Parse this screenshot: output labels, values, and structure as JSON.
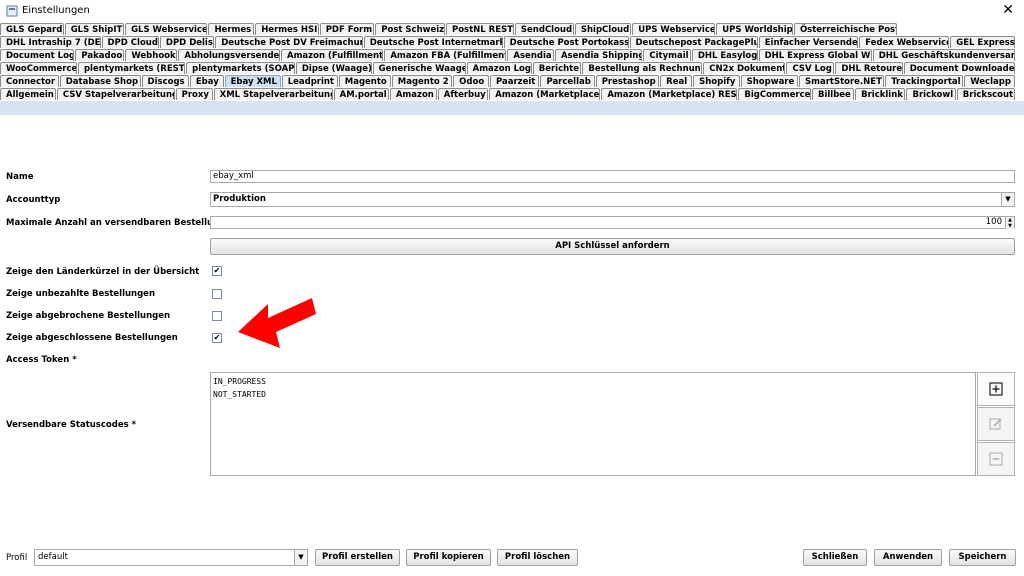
{
  "window": {
    "title": "Einstellungen"
  },
  "tabs": {
    "row1": [
      "GLS Gepard",
      "GLS ShipIT",
      "GLS Webservice",
      "Hermes",
      "Hermes HSI",
      "PDF Form",
      "Post Schweiz",
      "PostNL REST",
      "SendCloud",
      "ShipCloud",
      "UPS Webservice",
      "UPS Worldship",
      "Österreichische Post"
    ],
    "row2": [
      "DHL Intraship 7 (DE)",
      "DPD Cloud",
      "DPD Delis",
      "Deutsche Post DV Freimachung",
      "Deutsche Post Internetmarke",
      "Deutsche Post Portokasse",
      "Deutschepost PackagePlus",
      "Einfacher Versender",
      "Fedex Webservice",
      "GEL Express"
    ],
    "row3": [
      "Document Log",
      "Pakadoo",
      "Webhook",
      "Abholungsversender",
      "Amazon (Fulfillment)",
      "Amazon FBA (Fulfillment)",
      "Asendia",
      "Asendia Shipping",
      "Citymail",
      "DHL Easylog",
      "DHL Express Global WS",
      "DHL Geschäftskundenversand"
    ],
    "row4": [
      "WooCommerce",
      "plentymarkets (REST)",
      "plentymarkets (SOAP)",
      "Dipse (Waage)",
      "Generische Waage",
      "Amazon Log",
      "Berichte",
      "Bestellung als Rechnung",
      "CN2x Dokument",
      "CSV Log",
      "DHL Retoure",
      "Document Downloader"
    ],
    "row5": [
      "Connector",
      "Database Shop",
      "Discogs",
      "Ebay",
      "Ebay XML",
      "Leadprint",
      "Magento",
      "Magento 2",
      "Odoo",
      "Paarzeit",
      "Parcellab",
      "Prestashop",
      "Real",
      "Shopify",
      "Shopware",
      "SmartStore.NET",
      "Trackingportal",
      "Weclapp"
    ],
    "row6": [
      "Allgemein",
      "CSV Stapelverarbeitung",
      "Proxy",
      "XML Stapelverarbeitung",
      "AM.portal",
      "Amazon",
      "Afterbuy",
      "Amazon (Marketplace)",
      "Amazon (Marketplace) REST",
      "BigCommerce",
      "Billbee",
      "Bricklink",
      "Brickowl",
      "Brickscout"
    ],
    "active": "Ebay XML"
  },
  "form": {
    "name_label": "Name",
    "name_value": "ebay_xml",
    "accounttype_label": "Accounttyp",
    "accounttype_value": "Produktion",
    "max_orders_label": "Maximale Anzahl an versendbaren Bestellungen",
    "max_orders_value": "100",
    "api_button": "API Schlüssel anfordern",
    "show_country_label": "Zeige den Länderkürzel in der Übersicht",
    "show_unpaid_label": "Zeige unbezahlte Bestellungen",
    "show_cancelled_label": "Zeige abgebrochene Bestellungen",
    "show_completed_label": "Zeige abgeschlossene Bestellungen",
    "checks": {
      "country": true,
      "unpaid": false,
      "cancelled": false,
      "completed": true
    },
    "access_token_label": "Access Token *",
    "access_token_value": "",
    "status_label": "Versendbare Statuscodes *",
    "status_codes": [
      "IN_PROGRESS",
      "NOT_STARTED"
    ]
  },
  "footer": {
    "profile_label": "Profil",
    "profile_value": "default",
    "create": "Profil erstellen",
    "copy": "Profil kopieren",
    "delete": "Profil löschen",
    "close": "Schließen",
    "apply": "Anwenden",
    "save": "Speichern"
  },
  "colors": {
    "active_tab": "#cfe0f2",
    "arrow": "#ff0000"
  },
  "icons": {
    "app": "window-app-icon",
    "close": "close-icon",
    "arrow": "red-arrow-annotation"
  }
}
